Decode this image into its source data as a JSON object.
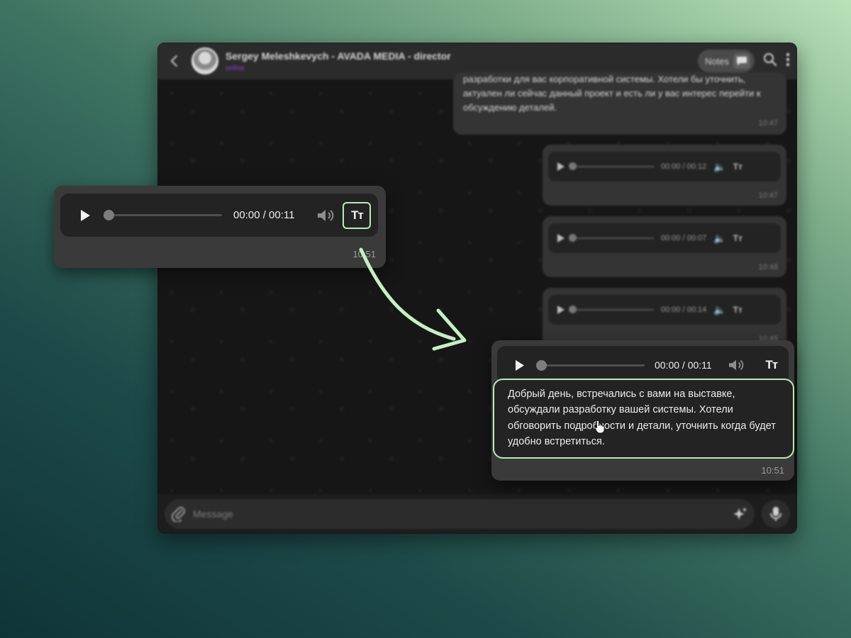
{
  "header": {
    "title": "Sergey Meleshkevych - AVADA MEDIA - director",
    "status": "online",
    "notes_label": "Notes"
  },
  "messages": [
    {
      "text": "разработки для вас корпоративной системы. Хотели бы уточнить, актуален ли сейчас данный проект и есть ли у вас интерес перейти к обсуждению деталей.",
      "time": "10:47"
    },
    {
      "duration": "00:00 / 00:12",
      "time": "10:47"
    },
    {
      "duration": "00:00 / 00:07",
      "time": "10:48"
    },
    {
      "duration": "00:00 / 00:14",
      "time": "10:49"
    }
  ],
  "composer": {
    "placeholder": "Message"
  },
  "callout_before": {
    "duration": "00:00 / 00:11",
    "transcribe_label": "Тт",
    "time": "10:51"
  },
  "callout_after": {
    "duration": "00:00 / 00:11",
    "transcribe_label": "Тт",
    "transcript": "Добрый день, встречались с вами на выставке, обсуждали разработку вашей системы. Хотели обговорить подробности и детали, уточнить когда будет удобно встретиться.",
    "time": "10:51"
  },
  "colors": {
    "highlight": "#b9ebb6",
    "arrow": "#c5f0c2",
    "status_online": "#8b3fd1",
    "bubble": "#343434",
    "player": "#232323"
  },
  "icons": [
    "back-arrow-icon",
    "avatar",
    "notes-chat-icon",
    "search-icon",
    "more-vertical-icon",
    "play-icon",
    "volume-icon",
    "text-transcribe-icon",
    "attach-paperclip-icon",
    "sparkle-icon",
    "microphone-icon",
    "hand-cursor-icon",
    "curved-arrow"
  ]
}
